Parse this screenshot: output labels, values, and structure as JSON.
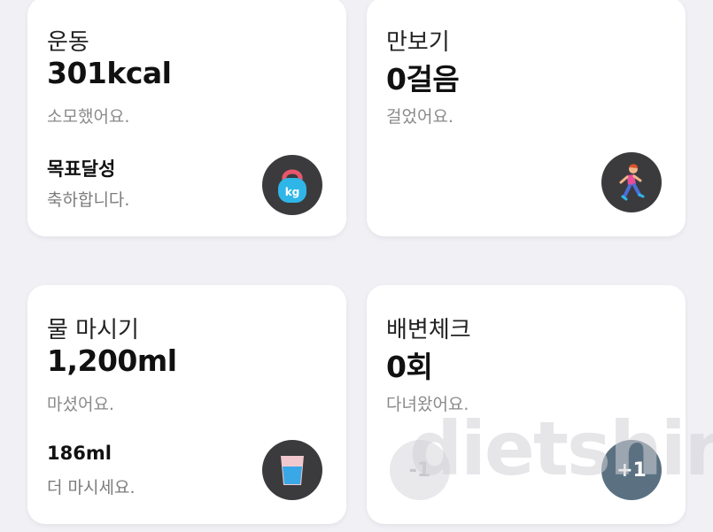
{
  "cards": {
    "exercise": {
      "title": "운동",
      "value": "301kcal",
      "desc": "소모했어요.",
      "goal_title": "목표달성",
      "goal_sub": "축하합니다.",
      "icon": "kettlebell-icon",
      "icon_badge": "kg"
    },
    "steps": {
      "title": "만보기",
      "value": "0걸음",
      "desc": "걸었어요.",
      "icon": "runner-icon"
    },
    "water": {
      "title": "물 마시기",
      "value": "1,200ml",
      "desc": "마셨어요.",
      "goal_title": "186ml",
      "goal_sub": "더 마시세요.",
      "icon": "water-glass-icon"
    },
    "bowel": {
      "title": "배변체크",
      "value": "0회",
      "desc": "다녀왔어요.",
      "minus_label": "-1",
      "plus_label": "+1"
    }
  },
  "watermark": "dietshin"
}
